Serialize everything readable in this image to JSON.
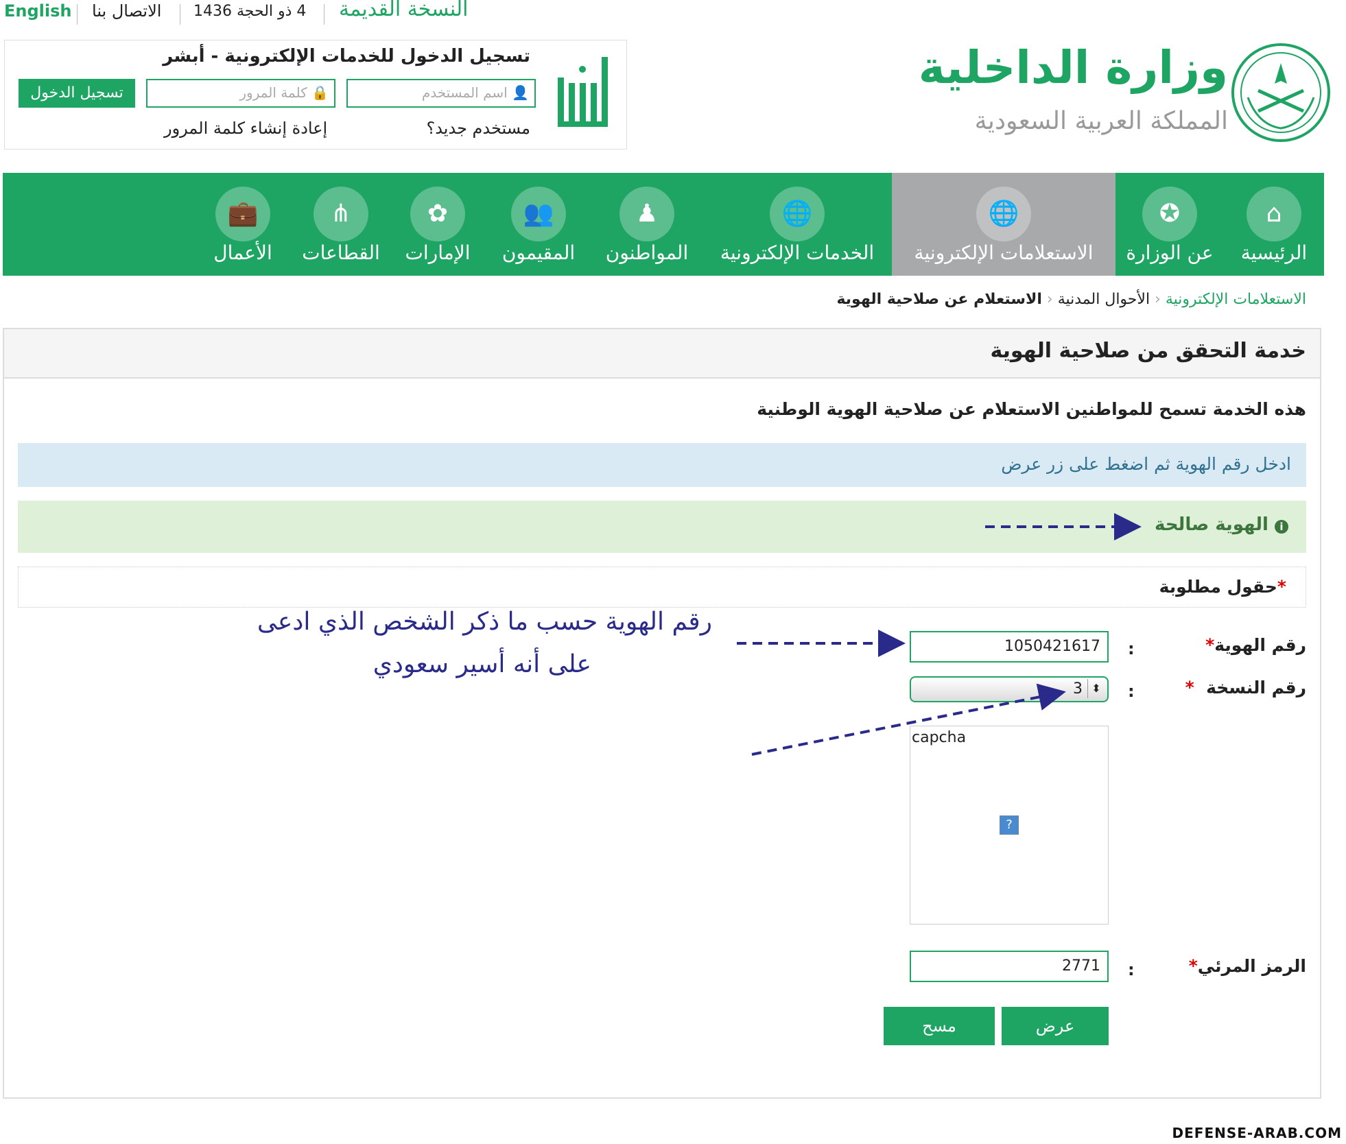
{
  "topbar": {
    "english": "English",
    "contact": "الاتصال بنا",
    "date": "4 ذو الحجة 1436",
    "old_version": "النسخة القديمة"
  },
  "login": {
    "title": "تسجيل الدخول للخدمات الإلكترونية - أبشر",
    "username_placeholder": "اسم المستخدم",
    "password_placeholder": "كلمة المرور",
    "login_button": "تسجيل الدخول",
    "new_user": "مستخدم جديد؟",
    "reset_password": "إعادة إنشاء كلمة المرور"
  },
  "logo": {
    "ministry": "وزارة الداخلية",
    "kingdom": "المملكة العربية السعودية"
  },
  "nav": {
    "items": [
      {
        "label": "الرئيسية",
        "icon": "home-icon"
      },
      {
        "label": "عن الوزارة",
        "icon": "emblem-icon"
      },
      {
        "label": "الاستعلامات الإلكترونية",
        "icon": "globe-search-icon"
      },
      {
        "label": "الخدمات الإلكترونية",
        "icon": "globe-icon"
      },
      {
        "label": "المواطنون",
        "icon": "citizen-icon"
      },
      {
        "label": "المقيمون",
        "icon": "people-icon"
      },
      {
        "label": "الإمارات",
        "icon": "map-icon"
      },
      {
        "label": "القطاعات",
        "icon": "share-icon"
      },
      {
        "label": "الأعمال",
        "icon": "briefcase-icon"
      }
    ],
    "active_index": 2
  },
  "breadcrumb": {
    "items": [
      "الاستعلامات الإلكترونية",
      "الأحوال المدنية",
      "الاستعلام عن صلاحية الهوية"
    ]
  },
  "panel": {
    "title": "خدمة التحقق من صلاحية الهوية",
    "description": "هذه الخدمة تسمح للمواطنين الاستعلام عن صلاحية الهوية الوطنية",
    "instruction": "ادخل رقم الهوية ثم اضغط على زر عرض",
    "result": "الهوية صالحة",
    "required_note": "حقول مطلوبة",
    "id_label": "رقم الهوية",
    "id_value": "1050421617",
    "version_label": "رقم النسخة",
    "version_value": "3",
    "captcha_alt": "capcha",
    "captcha_label": "الرمز المرئي",
    "captcha_value": "2771",
    "show_button": "عرض",
    "clear_button": "مسح",
    "colon": ":",
    "star": "*"
  },
  "annotation": {
    "line1": "رقم الهوية حسب ما ذكر الشخص الذي ادعى",
    "line2": "على أنه أسير سعودي"
  },
  "watermark": "DEFENSE-ARAB.COM",
  "colors": {
    "brand_green": "#1ea463",
    "active_nav": "#a7a9ab",
    "info_bg": "#d9eaf5",
    "success_bg": "#dff0d8",
    "annotation": "#2a2a8a"
  }
}
